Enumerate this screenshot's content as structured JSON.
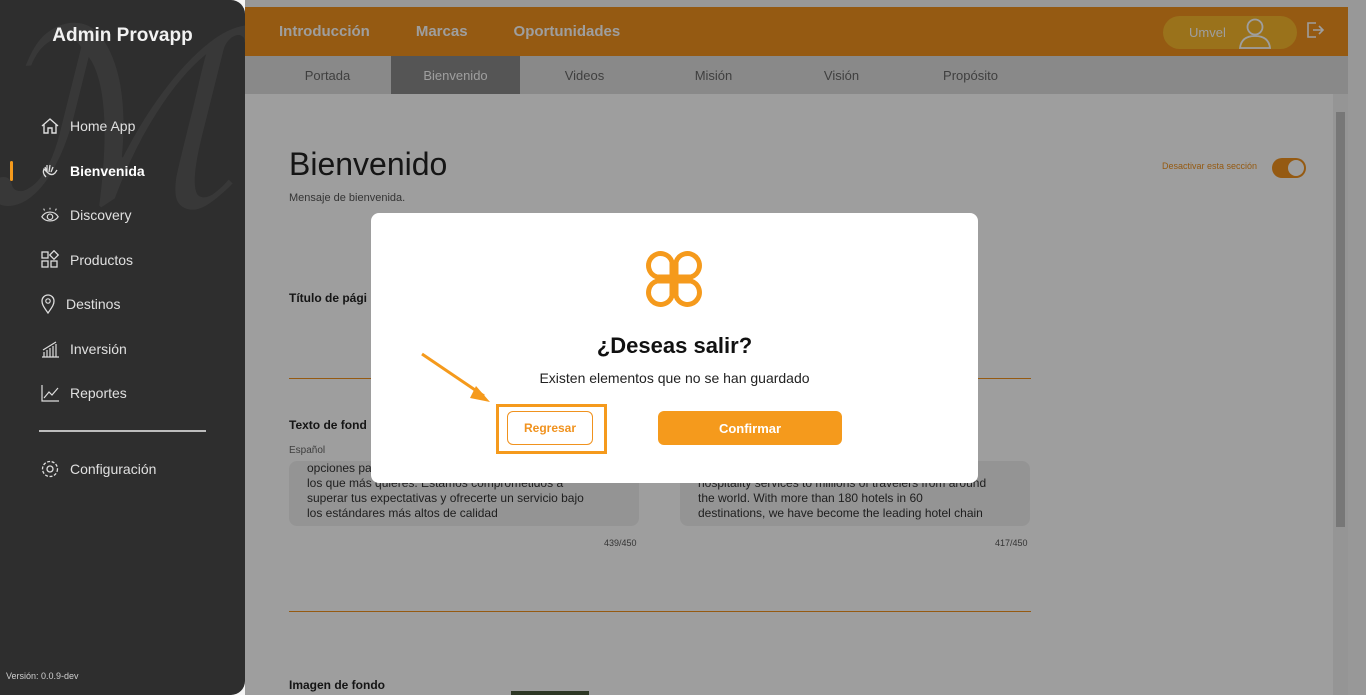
{
  "sidebar": {
    "brand": "Admin Provapp",
    "items": [
      {
        "label": "Home App",
        "icon": "home-icon"
      },
      {
        "label": "Bienvenida",
        "icon": "wave-hand-icon",
        "active": true
      },
      {
        "label": "Discovery",
        "icon": "eye-icon"
      },
      {
        "label": "Productos",
        "icon": "grid-icon"
      },
      {
        "label": "Destinos",
        "icon": "map-pin-icon"
      },
      {
        "label": "Inversión",
        "icon": "bar-chart-icon"
      },
      {
        "label": "Reportes",
        "icon": "line-chart-icon"
      }
    ],
    "config": {
      "label": "Configuración",
      "icon": "gear-icon"
    },
    "version": "Versión: 0.0.9-dev"
  },
  "topbar": {
    "nav": [
      "Introducción",
      "Marcas",
      "Oportunidades"
    ],
    "user_name": "Umvel"
  },
  "subtabs": [
    "Portada",
    "Bienvenido",
    "Videos",
    "Misión",
    "Visión",
    "Propósito"
  ],
  "content": {
    "title": "Bienvenido",
    "subtitle": "Mensaje de bienvenida.",
    "toggle_label": "Desactivar esta sección",
    "page_title_label": "Título de pági",
    "background_text_label": "Texto de fond",
    "lang_label": "Español",
    "textbox_es": [
      "opciones pa",
      "los que más quieres. Estamos comprometidos a",
      "superar tus expectativas y ofrecerte un servicio bajo",
      "los estándares más altos de calidad"
    ],
    "textbox_en": [
      "hospitality services to millions of travelers from around",
      "the world. With more than 180 hotels in 60",
      "destinations, we have become the leading hotel chain"
    ],
    "counter_es": "439/450",
    "counter_en": "417/450",
    "image_label": "Imagen de fondo"
  },
  "modal": {
    "title": "¿Deseas salir?",
    "message": "Existen elementos que no se han guardado",
    "back_label": "Regresar",
    "confirm_label": "Confirmar"
  },
  "colors": {
    "accent": "#f0921e",
    "sidebar": "#2e2e2e"
  }
}
